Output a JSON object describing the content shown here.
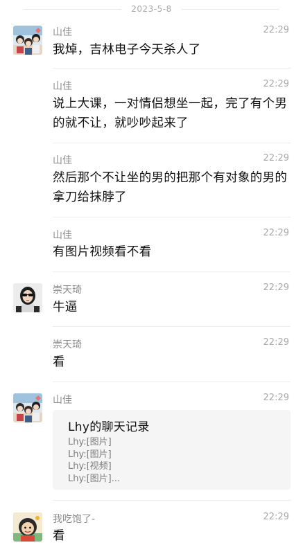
{
  "date_separator": "2023-5-8",
  "messages": [
    {
      "sender": "山佳",
      "time": "22:29",
      "text": "我焯，吉林电子今天杀人了"
    },
    {
      "sender": "山佳",
      "time": "22:29",
      "text": "说上大课，一对情侣想坐一起，完了有个男的就不让，就吵吵起来了"
    },
    {
      "sender": "山佳",
      "time": "22:29",
      "text": "然后那个不让坐的男的把那个有对象的男的拿刀给抹脖了"
    },
    {
      "sender": "山佳",
      "time": "22:29",
      "text": "有图片视频看不看"
    },
    {
      "sender": "崇天琦",
      "time": "22:29",
      "text": "牛逼"
    },
    {
      "sender": "崇天琦",
      "time": "22:29",
      "text": "看"
    },
    {
      "sender": "山佳",
      "time": "22:29",
      "card": {
        "title": "Lhy的聊天记录",
        "lines": [
          "Lhy:[图片]",
          "Lhy:[图片]",
          "Lhy:[视频]",
          "Lhy:[图片]..."
        ]
      }
    },
    {
      "sender": "我吃饱了-",
      "time": "22:29",
      "text": "看"
    }
  ],
  "avatars": {
    "shanjia": "anime-group-avatar",
    "chongtianqi": "sunglasses-girl-avatar",
    "wochibaole": "cartoon-character-avatar"
  }
}
